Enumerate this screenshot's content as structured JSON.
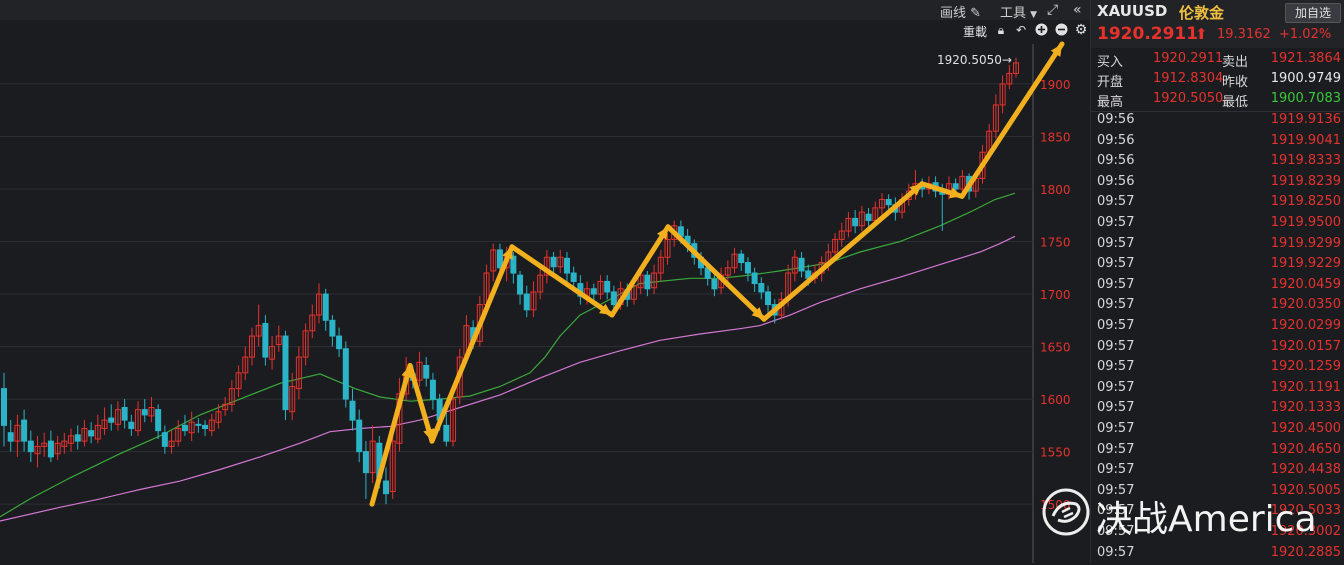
{
  "toolbar": {
    "draw_label": "画线",
    "tools_label": "工具",
    "reload_label": "重載"
  },
  "colors": {
    "up": "#e5322d",
    "down": "#2bb4c8",
    "ma_green": "#3aa83a",
    "ma_magenta": "#d377d3",
    "arrow": "#f2b01e",
    "grid": "#2d2e34"
  },
  "chart_data": {
    "type": "candlestick",
    "y_ticks": [
      1500,
      1550,
      1600,
      1650,
      1700,
      1750,
      1800,
      1850,
      1900
    ],
    "ylim": [
      1444,
      1938
    ],
    "last_label": "1920.5050→",
    "candles": [
      [
        1610,
        1575,
        1625,
        1555
      ],
      [
        1568,
        1560,
        1580,
        1550
      ],
      [
        1560,
        1575,
        1585,
        1545
      ],
      [
        1580,
        1560,
        1590,
        1550
      ],
      [
        1560,
        1550,
        1570,
        1540
      ],
      [
        1548,
        1555,
        1565,
        1535
      ],
      [
        1555,
        1558,
        1568,
        1545
      ],
      [
        1560,
        1545,
        1570,
        1540
      ],
      [
        1548,
        1558,
        1565,
        1542
      ],
      [
        1555,
        1560,
        1568,
        1548
      ],
      [
        1558,
        1565,
        1572,
        1550
      ],
      [
        1566,
        1560,
        1575,
        1552
      ],
      [
        1560,
        1572,
        1580,
        1555
      ],
      [
        1570,
        1565,
        1578,
        1558
      ],
      [
        1562,
        1575,
        1585,
        1558
      ],
      [
        1572,
        1580,
        1592,
        1566
      ],
      [
        1582,
        1578,
        1595,
        1570
      ],
      [
        1576,
        1590,
        1598,
        1570
      ],
      [
        1592,
        1580,
        1600,
        1572
      ],
      [
        1578,
        1572,
        1585,
        1565
      ],
      [
        1570,
        1590,
        1598,
        1565
      ],
      [
        1590,
        1585,
        1600,
        1578
      ],
      [
        1584,
        1592,
        1602,
        1578
      ],
      [
        1590,
        1570,
        1595,
        1562
      ],
      [
        1568,
        1555,
        1575,
        1548
      ],
      [
        1555,
        1560,
        1570,
        1548
      ],
      [
        1560,
        1572,
        1580,
        1555
      ],
      [
        1575,
        1570,
        1585,
        1565
      ],
      [
        1568,
        1578,
        1588,
        1560
      ],
      [
        1576,
        1575,
        1582,
        1568
      ],
      [
        1575,
        1572,
        1580,
        1565
      ],
      [
        1570,
        1580,
        1586,
        1565
      ],
      [
        1578,
        1588,
        1595,
        1572
      ],
      [
        1590,
        1595,
        1602,
        1584
      ],
      [
        1595,
        1610,
        1618,
        1588
      ],
      [
        1610,
        1625,
        1632,
        1602
      ],
      [
        1625,
        1640,
        1650,
        1618
      ],
      [
        1640,
        1660,
        1668,
        1632
      ],
      [
        1660,
        1670,
        1690,
        1650
      ],
      [
        1672,
        1640,
        1680,
        1632
      ],
      [
        1638,
        1650,
        1660,
        1628
      ],
      [
        1652,
        1660,
        1670,
        1645
      ],
      [
        1660,
        1590,
        1665,
        1580
      ],
      [
        1588,
        1612,
        1625,
        1580
      ],
      [
        1610,
        1640,
        1650,
        1600
      ],
      [
        1640,
        1665,
        1672,
        1632
      ],
      [
        1665,
        1680,
        1690,
        1658
      ],
      [
        1680,
        1700,
        1710,
        1672
      ],
      [
        1700,
        1675,
        1705,
        1665
      ],
      [
        1675,
        1660,
        1680,
        1650
      ],
      [
        1660,
        1648,
        1668,
        1640
      ],
      [
        1648,
        1600,
        1655,
        1592
      ],
      [
        1598,
        1580,
        1610,
        1570
      ],
      [
        1580,
        1550,
        1590,
        1540
      ],
      [
        1550,
        1530,
        1560,
        1505
      ],
      [
        1530,
        1560,
        1575,
        1520
      ],
      [
        1558,
        1525,
        1565,
        1515
      ],
      [
        1522,
        1510,
        1535,
        1500
      ],
      [
        1512,
        1560,
        1572,
        1505
      ],
      [
        1558,
        1605,
        1620,
        1550
      ],
      [
        1605,
        1625,
        1640,
        1598
      ],
      [
        1624,
        1618,
        1632,
        1610
      ],
      [
        1618,
        1635,
        1645,
        1612
      ],
      [
        1632,
        1620,
        1640,
        1612
      ],
      [
        1618,
        1600,
        1625,
        1590
      ],
      [
        1600,
        1580,
        1605,
        1570
      ],
      [
        1575,
        1560,
        1590,
        1555
      ],
      [
        1560,
        1600,
        1612,
        1555
      ],
      [
        1602,
        1640,
        1648,
        1595
      ],
      [
        1642,
        1670,
        1680,
        1636
      ],
      [
        1668,
        1655,
        1675,
        1648
      ],
      [
        1655,
        1690,
        1698,
        1650
      ],
      [
        1690,
        1720,
        1728,
        1682
      ],
      [
        1722,
        1742,
        1748,
        1712
      ],
      [
        1742,
        1725,
        1748,
        1715
      ],
      [
        1725,
        1738,
        1745,
        1712
      ],
      [
        1736,
        1720,
        1740,
        1710
      ],
      [
        1718,
        1700,
        1722,
        1690
      ],
      [
        1700,
        1685,
        1708,
        1678
      ],
      [
        1685,
        1702,
        1712,
        1678
      ],
      [
        1702,
        1718,
        1728,
        1695
      ],
      [
        1718,
        1735,
        1742,
        1710
      ],
      [
        1735,
        1726,
        1740,
        1718
      ],
      [
        1726,
        1735,
        1742,
        1720
      ],
      [
        1734,
        1720,
        1740,
        1712
      ],
      [
        1720,
        1712,
        1726,
        1702
      ],
      [
        1710,
        1698,
        1718,
        1690
      ],
      [
        1698,
        1705,
        1712,
        1690
      ],
      [
        1705,
        1700,
        1710,
        1692
      ],
      [
        1700,
        1712,
        1718,
        1695
      ],
      [
        1712,
        1702,
        1718,
        1695
      ],
      [
        1702,
        1690,
        1708,
        1682
      ],
      [
        1690,
        1705,
        1712,
        1685
      ],
      [
        1704,
        1695,
        1710,
        1688
      ],
      [
        1695,
        1708,
        1715,
        1690
      ],
      [
        1706,
        1718,
        1726,
        1700
      ],
      [
        1718,
        1705,
        1722,
        1698
      ],
      [
        1706,
        1720,
        1728,
        1700
      ],
      [
        1720,
        1735,
        1742,
        1712
      ],
      [
        1735,
        1752,
        1758,
        1728
      ],
      [
        1752,
        1765,
        1770,
        1745
      ],
      [
        1764,
        1755,
        1770,
        1748
      ],
      [
        1755,
        1748,
        1762,
        1740
      ],
      [
        1748,
        1735,
        1752,
        1728
      ],
      [
        1735,
        1725,
        1740,
        1718
      ],
      [
        1725,
        1715,
        1730,
        1708
      ],
      [
        1714,
        1705,
        1720,
        1698
      ],
      [
        1706,
        1718,
        1725,
        1700
      ],
      [
        1718,
        1725,
        1732,
        1712
      ],
      [
        1725,
        1738,
        1744,
        1720
      ],
      [
        1738,
        1730,
        1742,
        1722
      ],
      [
        1730,
        1720,
        1735,
        1712
      ],
      [
        1720,
        1710,
        1725,
        1702
      ],
      [
        1710,
        1702,
        1716,
        1695
      ],
      [
        1702,
        1690,
        1708,
        1682
      ],
      [
        1690,
        1680,
        1695,
        1672
      ],
      [
        1680,
        1695,
        1702,
        1676
      ],
      [
        1695,
        1720,
        1728,
        1688
      ],
      [
        1720,
        1735,
        1742,
        1712
      ],
      [
        1734,
        1722,
        1740,
        1716
      ],
      [
        1722,
        1715,
        1728,
        1708
      ],
      [
        1715,
        1720,
        1728,
        1710
      ],
      [
        1720,
        1730,
        1736,
        1712
      ],
      [
        1730,
        1740,
        1748,
        1722
      ],
      [
        1740,
        1752,
        1758,
        1735
      ],
      [
        1752,
        1760,
        1768,
        1745
      ],
      [
        1760,
        1772,
        1778,
        1754
      ],
      [
        1772,
        1765,
        1780,
        1758
      ],
      [
        1765,
        1778,
        1784,
        1760
      ],
      [
        1776,
        1770,
        1782,
        1762
      ],
      [
        1770,
        1782,
        1788,
        1765
      ],
      [
        1782,
        1790,
        1796,
        1775
      ],
      [
        1790,
        1785,
        1795,
        1778
      ],
      [
        1785,
        1778,
        1792,
        1770
      ],
      [
        1778,
        1790,
        1796,
        1772
      ],
      [
        1790,
        1798,
        1805,
        1784
      ],
      [
        1798,
        1805,
        1818,
        1790
      ],
      [
        1805,
        1800,
        1810,
        1792
      ],
      [
        1800,
        1805,
        1812,
        1795
      ],
      [
        1806,
        1798,
        1812,
        1792
      ],
      [
        1798,
        1795,
        1805,
        1760
      ],
      [
        1795,
        1805,
        1812,
        1790
      ],
      [
        1805,
        1800,
        1810,
        1795
      ],
      [
        1800,
        1812,
        1818,
        1794
      ],
      [
        1812,
        1798,
        1815,
        1790
      ],
      [
        1798,
        1810,
        1816,
        1792
      ],
      [
        1810,
        1835,
        1842,
        1805
      ],
      [
        1835,
        1855,
        1862,
        1828
      ],
      [
        1855,
        1880,
        1890,
        1848
      ],
      [
        1880,
        1900,
        1908,
        1872
      ],
      [
        1900,
        1910,
        1918,
        1895
      ],
      [
        1910,
        1920,
        1925,
        1906
      ]
    ],
    "ma_green": [
      [
        0,
        1488
      ],
      [
        30,
        1505
      ],
      [
        70,
        1525
      ],
      [
        120,
        1548
      ],
      [
        160,
        1565
      ],
      [
        200,
        1585
      ],
      [
        240,
        1600
      ],
      [
        280,
        1615
      ],
      [
        320,
        1624
      ],
      [
        355,
        1610
      ],
      [
        380,
        1602
      ],
      [
        410,
        1598
      ],
      [
        440,
        1600
      ],
      [
        470,
        1603
      ],
      [
        500,
        1612
      ],
      [
        530,
        1625
      ],
      [
        545,
        1640
      ],
      [
        560,
        1660
      ],
      [
        580,
        1680
      ],
      [
        600,
        1690
      ],
      [
        620,
        1700
      ],
      [
        640,
        1710
      ],
      [
        660,
        1712
      ],
      [
        690,
        1715
      ],
      [
        720,
        1715
      ],
      [
        750,
        1718
      ],
      [
        780,
        1722
      ],
      [
        800,
        1725
      ],
      [
        830,
        1730
      ],
      [
        860,
        1740
      ],
      [
        900,
        1750
      ],
      [
        940,
        1765
      ],
      [
        970,
        1778
      ],
      [
        995,
        1790
      ],
      [
        1015,
        1796
      ]
    ],
    "ma_magenta": [
      [
        0,
        1484
      ],
      [
        60,
        1497
      ],
      [
        100,
        1505
      ],
      [
        140,
        1514
      ],
      [
        180,
        1522
      ],
      [
        220,
        1533
      ],
      [
        260,
        1545
      ],
      [
        300,
        1558
      ],
      [
        330,
        1569
      ],
      [
        360,
        1572
      ],
      [
        390,
        1574
      ],
      [
        420,
        1580
      ],
      [
        460,
        1592
      ],
      [
        500,
        1604
      ],
      [
        540,
        1620
      ],
      [
        580,
        1635
      ],
      [
        620,
        1646
      ],
      [
        660,
        1656
      ],
      [
        700,
        1662
      ],
      [
        740,
        1667
      ],
      [
        760,
        1670
      ],
      [
        790,
        1680
      ],
      [
        820,
        1692
      ],
      [
        860,
        1705
      ],
      [
        900,
        1716
      ],
      [
        940,
        1728
      ],
      [
        980,
        1740
      ],
      [
        1000,
        1748
      ],
      [
        1015,
        1755
      ]
    ]
  },
  "quote": {
    "symbol": "XAUUSD",
    "name": "伦敦金",
    "add_watch": "加自选",
    "last": "1920.2911",
    "change": "19.3162",
    "change_pct": "+1.02%",
    "bid_label": "买入",
    "bid": "1920.2911",
    "ask_label": "卖出",
    "ask": "1921.3864",
    "open_label": "开盘",
    "open": "1912.8304",
    "prev_label": "昨收",
    "prev": "1900.9749",
    "high_label": "最高",
    "high": "1920.5050",
    "low_label": "最低",
    "low": "1900.7083"
  },
  "ticks": [
    {
      "t": "09:56",
      "p": "1919.9136"
    },
    {
      "t": "09:56",
      "p": "1919.9041"
    },
    {
      "t": "09:56",
      "p": "1919.8333"
    },
    {
      "t": "09:56",
      "p": "1919.8239"
    },
    {
      "t": "09:57",
      "p": "1919.8250"
    },
    {
      "t": "09:57",
      "p": "1919.9500"
    },
    {
      "t": "09:57",
      "p": "1919.9299"
    },
    {
      "t": "09:57",
      "p": "1919.9229"
    },
    {
      "t": "09:57",
      "p": "1920.0459"
    },
    {
      "t": "09:57",
      "p": "1920.0350"
    },
    {
      "t": "09:57",
      "p": "1920.0299"
    },
    {
      "t": "09:57",
      "p": "1920.0157"
    },
    {
      "t": "09:57",
      "p": "1920.1259"
    },
    {
      "t": "09:57",
      "p": "1920.1191"
    },
    {
      "t": "09:57",
      "p": "1920.1333"
    },
    {
      "t": "09:57",
      "p": "1920.4500"
    },
    {
      "t": "09:57",
      "p": "1920.4650"
    },
    {
      "t": "09:57",
      "p": "1920.4438"
    },
    {
      "t": "09:57",
      "p": "1920.5005"
    },
    {
      "t": "09:57",
      "p": "1920.5033"
    },
    {
      "t": "09:57",
      "p": "1920.3002"
    },
    {
      "t": "09:57",
      "p": "1920.2885"
    }
  ],
  "watermark": {
    "text": "决战America"
  }
}
